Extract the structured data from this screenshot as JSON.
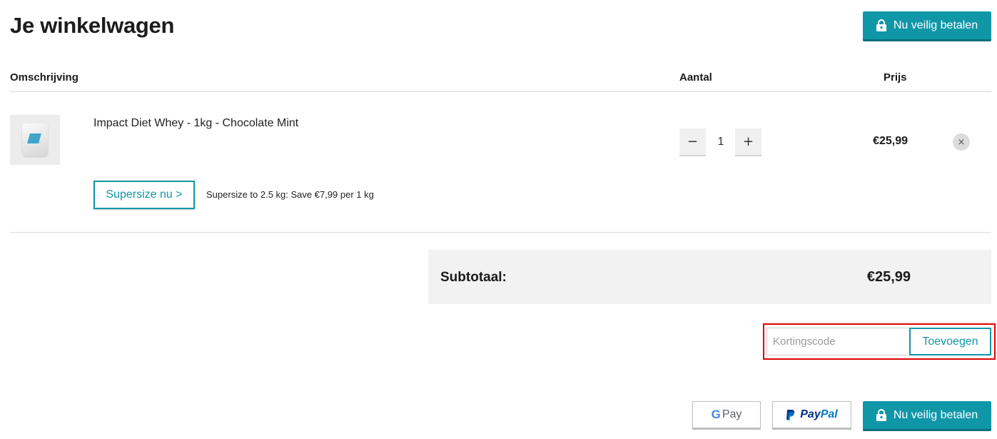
{
  "page": {
    "title": "Je winkelwagen",
    "checkout_label": "Nu veilig betalen"
  },
  "table": {
    "headers": {
      "description": "Omschrijving",
      "quantity": "Aantal",
      "price": "Prijs"
    }
  },
  "items": [
    {
      "name": "Impact Diet Whey - 1kg - Chocolate Mint",
      "quantity": "1",
      "decrement_label": "−",
      "increment_label": "+",
      "price": "€25,99",
      "remove_label": "×",
      "upsell": {
        "button_label": "Supersize nu >",
        "text": "Supersize to 2.5 kg: Save €7,99 per 1 kg"
      }
    }
  ],
  "summary": {
    "subtotal_label": "Subtotaal:",
    "subtotal_value": "€25,99"
  },
  "coupon": {
    "placeholder": "Kortingscode",
    "button_label": "Toevoegen"
  },
  "payment_options": {
    "gpay_g": "G",
    "gpay_label": "Pay",
    "paypal_pay": "Pay",
    "paypal_pal": "Pal"
  },
  "colors": {
    "accent": "#0f97a8",
    "highlight": "#e00000"
  }
}
